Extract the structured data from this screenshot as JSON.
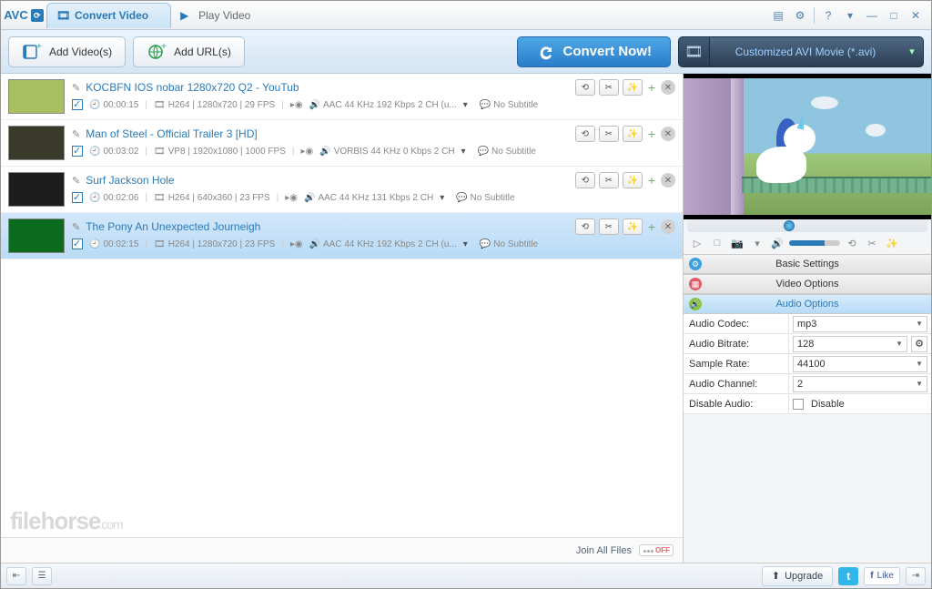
{
  "app": {
    "logo": "AVC"
  },
  "tabs": {
    "convert": "Convert Video",
    "play": "Play Video"
  },
  "toolbar": {
    "add_videos": "Add Video(s)",
    "add_urls": "Add URL(s)",
    "convert_now": "Convert Now!"
  },
  "profile": {
    "label": "Customized AVI Movie (*.avi)"
  },
  "videos": [
    {
      "title": "KOCBFN IOS nobar 1280x720 Q2 - YouTub",
      "duration": "00:00:15",
      "video": "H264 | 1280x720 | 29 FPS",
      "audio": "AAC 44 KHz 192 Kbps 2 CH (u...",
      "subtitle": "No Subtitle",
      "thumb_bg": "#a8c060"
    },
    {
      "title": "Man of Steel - Official Trailer 3 [HD]",
      "duration": "00:03:02",
      "video": "VP8 | 1920x1080 | 1000 FPS",
      "audio": "VORBIS 44 KHz 0 Kbps 2 CH",
      "subtitle": "No Subtitle",
      "thumb_bg": "#3a3a2a"
    },
    {
      "title": "Surf Jackson Hole",
      "duration": "00:02:06",
      "video": "H264 | 640x360 | 23 FPS",
      "audio": "AAC 44 KHz 131 Kbps 2 CH",
      "subtitle": "No Subtitle",
      "thumb_bg": "#1c1c1c"
    },
    {
      "title": "The Pony An Unexpected Journeigh",
      "duration": "00:02:15",
      "video": "H264 | 1280x720 | 23 FPS",
      "audio": "AAC 44 KHz 192 Kbps 2 CH (u...",
      "subtitle": "No Subtitle",
      "thumb_bg": "#0a6b1f",
      "selected": true
    }
  ],
  "list_footer": {
    "join": "Join All Files",
    "off": "OFF"
  },
  "watermark": {
    "main": "filehorse",
    "suffix": ".com"
  },
  "panel": {
    "basic": "Basic Settings",
    "video": "Video Options",
    "audio": "Audio Options",
    "rows": {
      "codec_label": "Audio Codec:",
      "codec_value": "mp3",
      "bitrate_label": "Audio Bitrate:",
      "bitrate_value": "128",
      "sample_label": "Sample Rate:",
      "sample_value": "44100",
      "channel_label": "Audio Channel:",
      "channel_value": "2",
      "disable_label": "Disable Audio:",
      "disable_value": "Disable"
    }
  },
  "statusbar": {
    "upgrade": "Upgrade",
    "like": "Like"
  }
}
